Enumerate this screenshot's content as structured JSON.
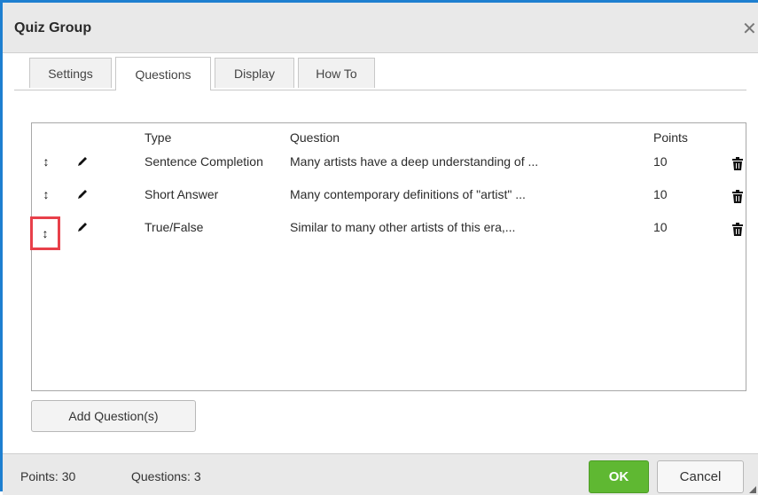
{
  "dialog": {
    "title": "Quiz Group",
    "close_glyph": "✕"
  },
  "tabs": [
    {
      "label": "Settings",
      "active": false
    },
    {
      "label": "Questions",
      "active": true
    },
    {
      "label": "Display",
      "active": false
    },
    {
      "label": "How To",
      "active": false
    }
  ],
  "grid": {
    "headers": {
      "type": "Type",
      "question": "Question",
      "points": "Points"
    },
    "rows": [
      {
        "type": "Sentence Completion",
        "question": "Many artists have a deep understanding of ...",
        "points": "10"
      },
      {
        "type": "Short Answer",
        "question": "Many contemporary definitions of \"artist\" ...",
        "points": "10"
      },
      {
        "type": "True/False",
        "question": "Similar to many other artists of this era,...",
        "points": "10"
      }
    ],
    "icons": {
      "move": "move-vertical-icon",
      "edit": "pencil-icon",
      "delete": "trash-icon"
    },
    "move_glyph": "↕"
  },
  "add_button": "Add Question(s)",
  "footer": {
    "points": "Points: 30",
    "questions": "Questions: 3",
    "ok": "OK",
    "cancel": "Cancel"
  },
  "colors": {
    "accent_border": "#1e7fd0",
    "ok_green": "#5fb832",
    "highlight_red": "#e8404a"
  }
}
